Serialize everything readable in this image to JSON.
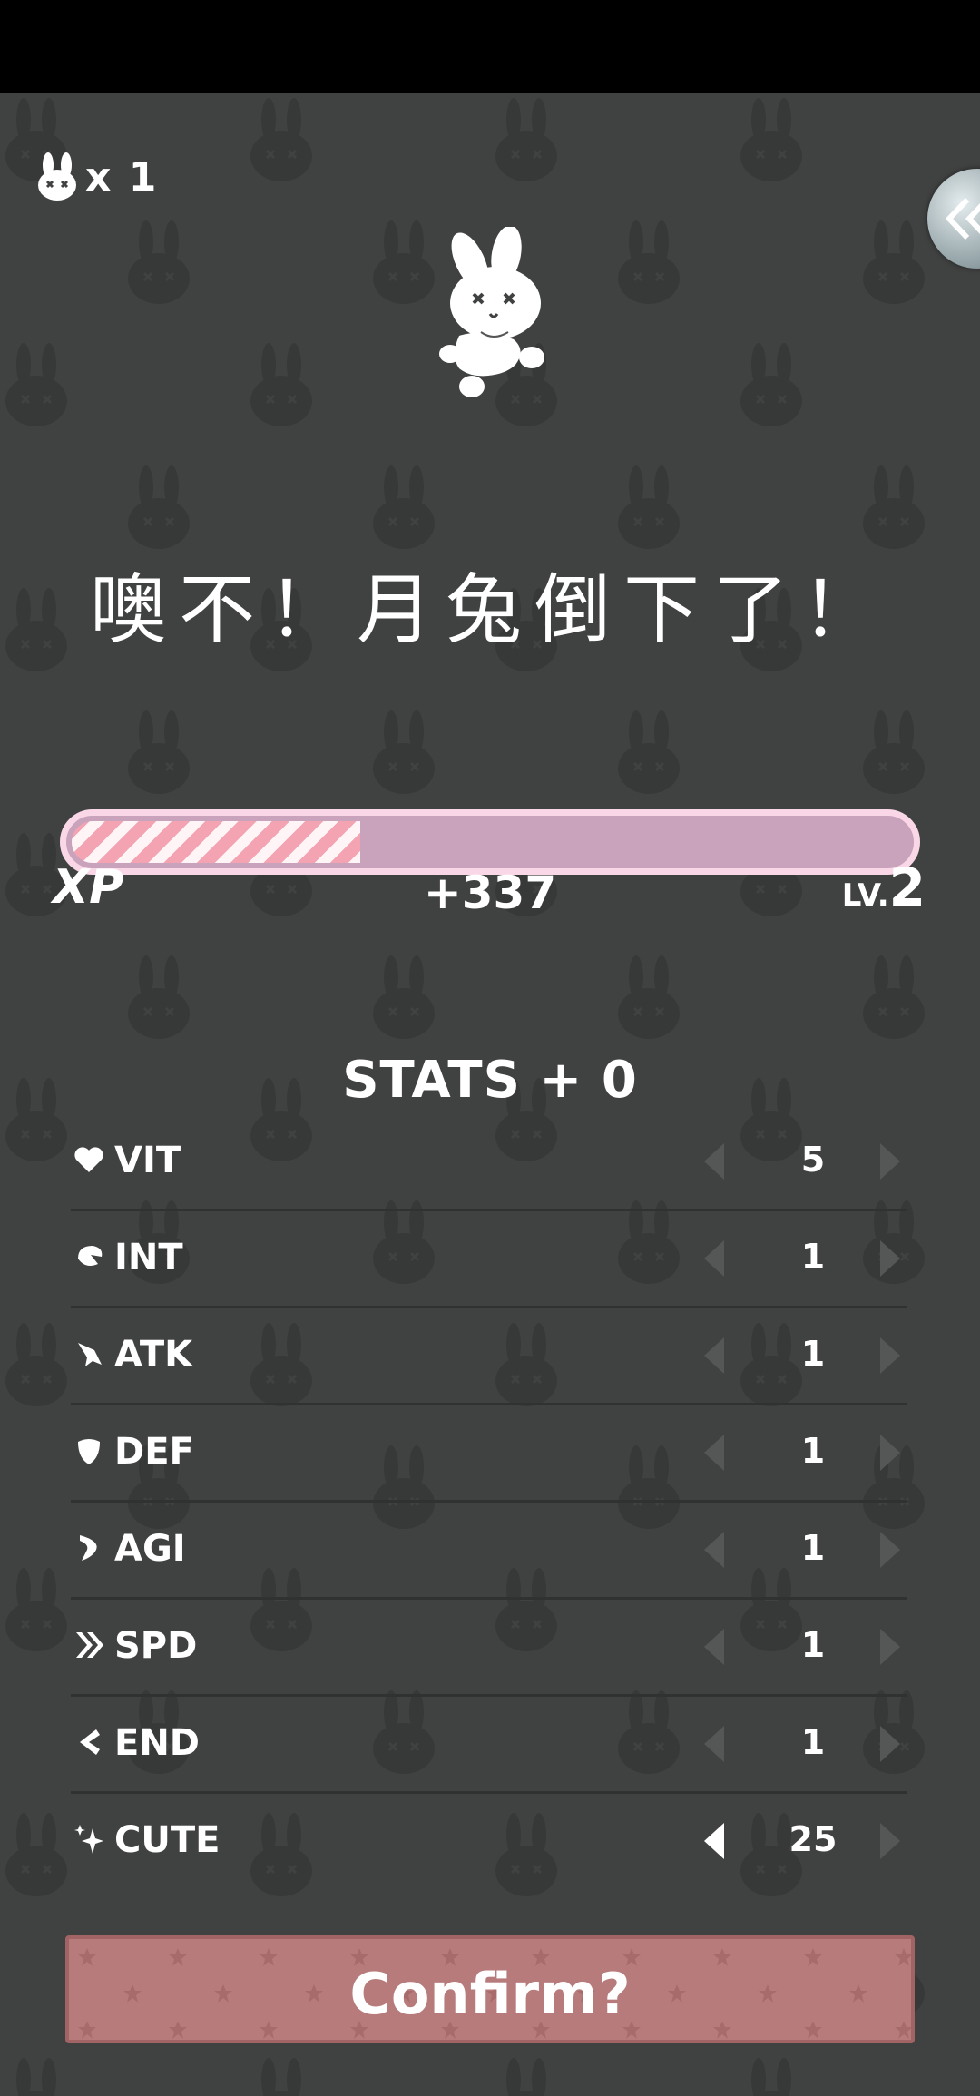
{
  "lives": {
    "text": "x 1"
  },
  "title": "噢不！月兔倒下了！",
  "xp": {
    "label": "XP",
    "gain": "+337",
    "level_prefix": "LV.",
    "level_value": "2",
    "progress": 0.34
  },
  "stats_header": "STATS + 0",
  "stats": [
    {
      "name": "VIT",
      "value": "5",
      "icon": "heart-icon"
    },
    {
      "name": "INT",
      "value": "1",
      "icon": "brain-icon"
    },
    {
      "name": "ATK",
      "value": "1",
      "icon": "sword-icon"
    },
    {
      "name": "DEF",
      "value": "1",
      "icon": "shield-icon"
    },
    {
      "name": "AGI",
      "value": "1",
      "icon": "agility-icon"
    },
    {
      "name": "SPD",
      "value": "1",
      "icon": "double-chevron-icon"
    },
    {
      "name": "END",
      "value": "1",
      "icon": "endurance-icon"
    },
    {
      "name": "CUTE",
      "value": "25",
      "icon": "sparkle-icon"
    }
  ],
  "confirm_label": "Confirm?",
  "colors": {
    "background": "#404141",
    "xp_fill": "#f3a3b2",
    "xp_track": "#c9a2bb",
    "confirm": "#b77b7c"
  }
}
